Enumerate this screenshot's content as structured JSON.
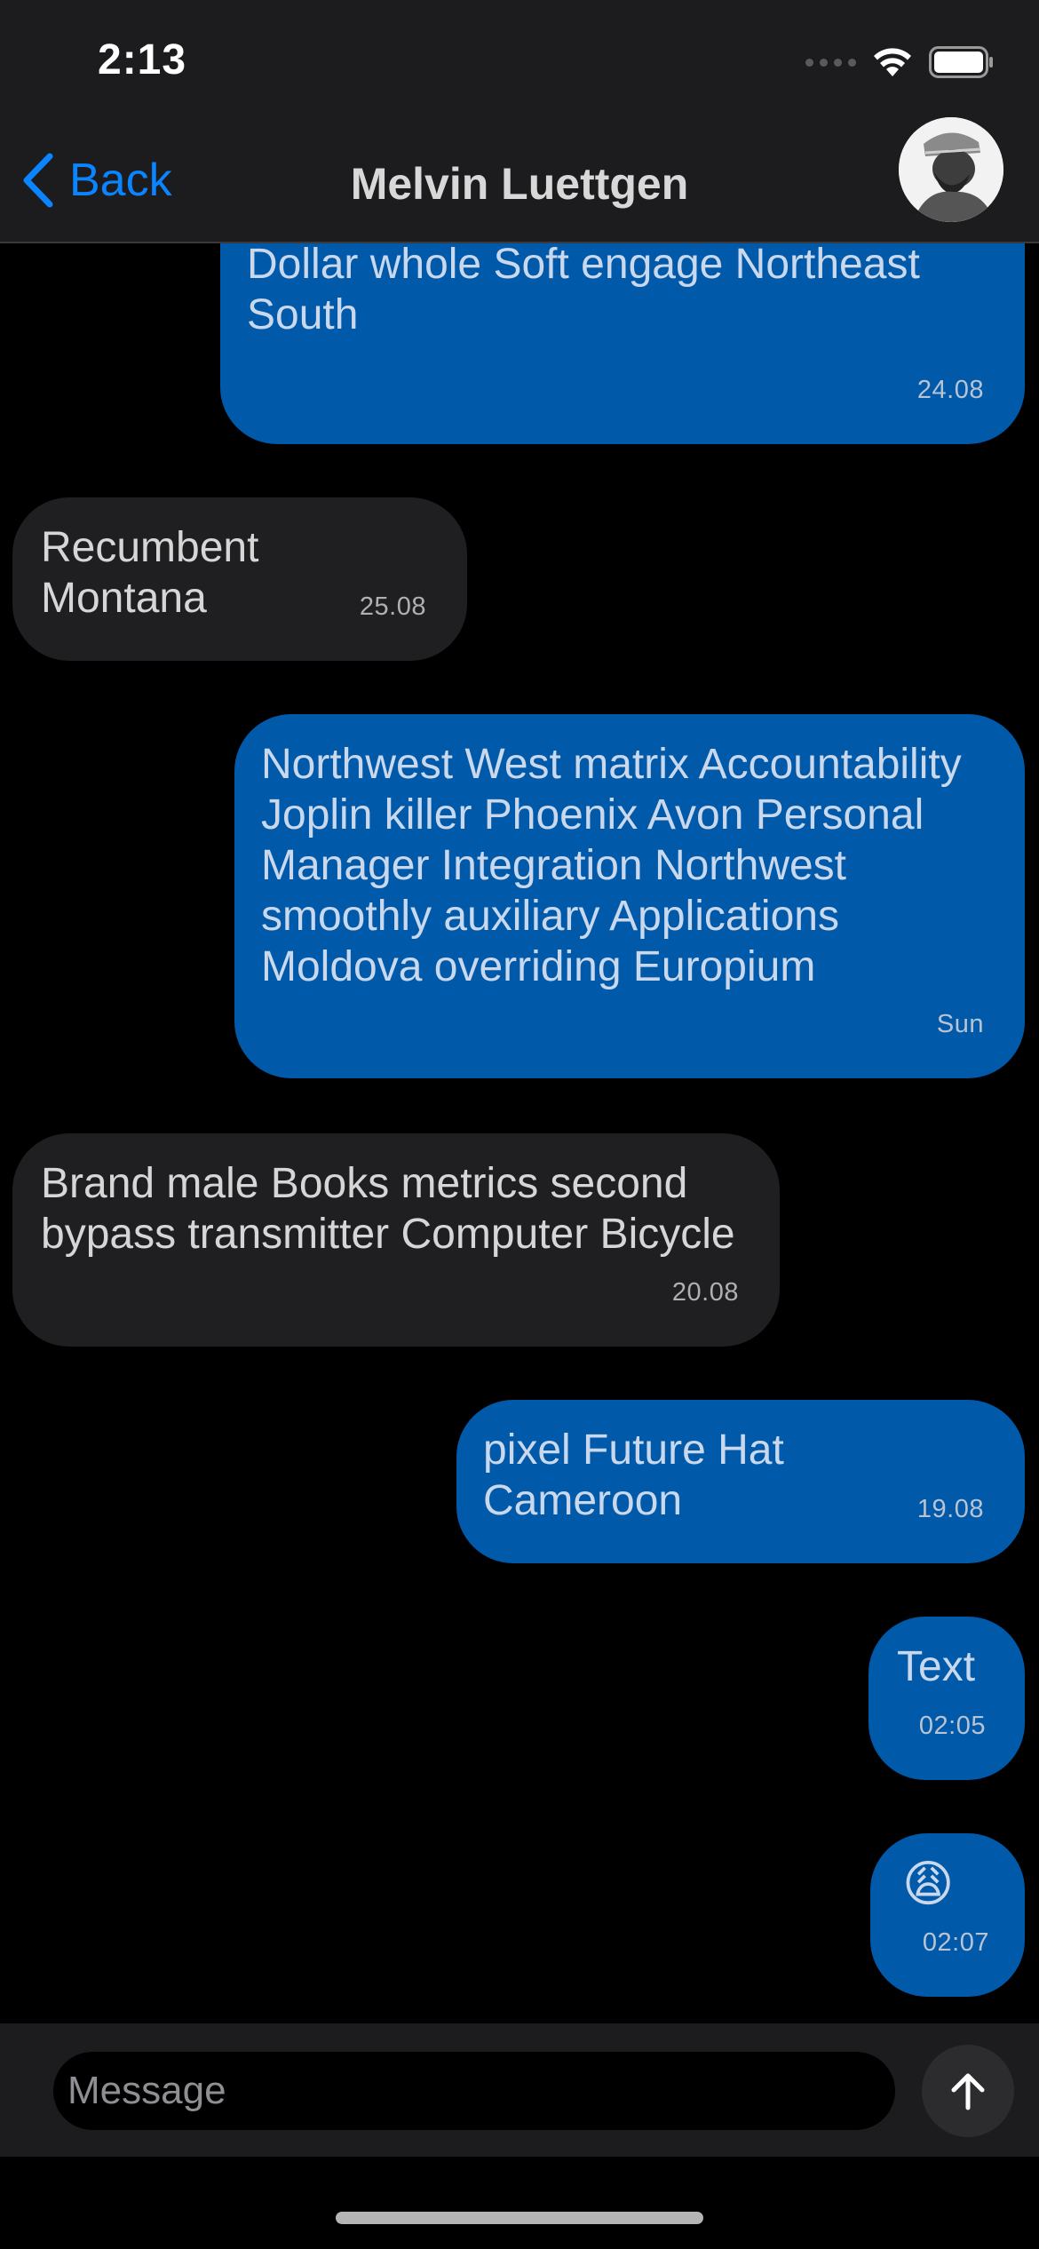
{
  "status_bar": {
    "time": "2:13"
  },
  "nav": {
    "back_label": "Back",
    "title": "Melvin Luettgen"
  },
  "messages": [
    {
      "direction": "outgoing",
      "text": "Latin Northwest of Malaysia while New\nDollar whole Soft engage Northeast\nSouth",
      "time": "24.08"
    },
    {
      "direction": "incoming",
      "text": "Recumbent Montana",
      "time": "25.08"
    },
    {
      "direction": "outgoing",
      "text": "Northwest West matrix Accountability\nJoplin killer Phoenix Avon Personal\nManager Integration Northwest\nsmoothly auxiliary Applications\nMoldova overriding Europium",
      "time": "Sun"
    },
    {
      "direction": "incoming",
      "text": "Brand male Books metrics second\nbypass transmitter Computer Bicycle",
      "time": "20.08"
    },
    {
      "direction": "outgoing",
      "text": "pixel Future Hat Cameroon",
      "time": "19.08"
    },
    {
      "direction": "outgoing",
      "text": "Text",
      "time": "02:05"
    },
    {
      "direction": "outgoing",
      "text": "😩",
      "time": "02:07"
    }
  ],
  "composer": {
    "placeholder": "Message",
    "value": ""
  },
  "colors": {
    "accent": "#0a84ff",
    "outgoing_bubble": "#0059a9",
    "incoming_bubble": "#1f1f21",
    "bar_background": "#1c1c1e",
    "background": "#000000"
  },
  "icons": {
    "back": "chevron-left-icon",
    "send": "arrow-up-icon",
    "wifi": "wifi-icon",
    "battery": "battery-icon",
    "signal": "cellular-signal-icon"
  }
}
